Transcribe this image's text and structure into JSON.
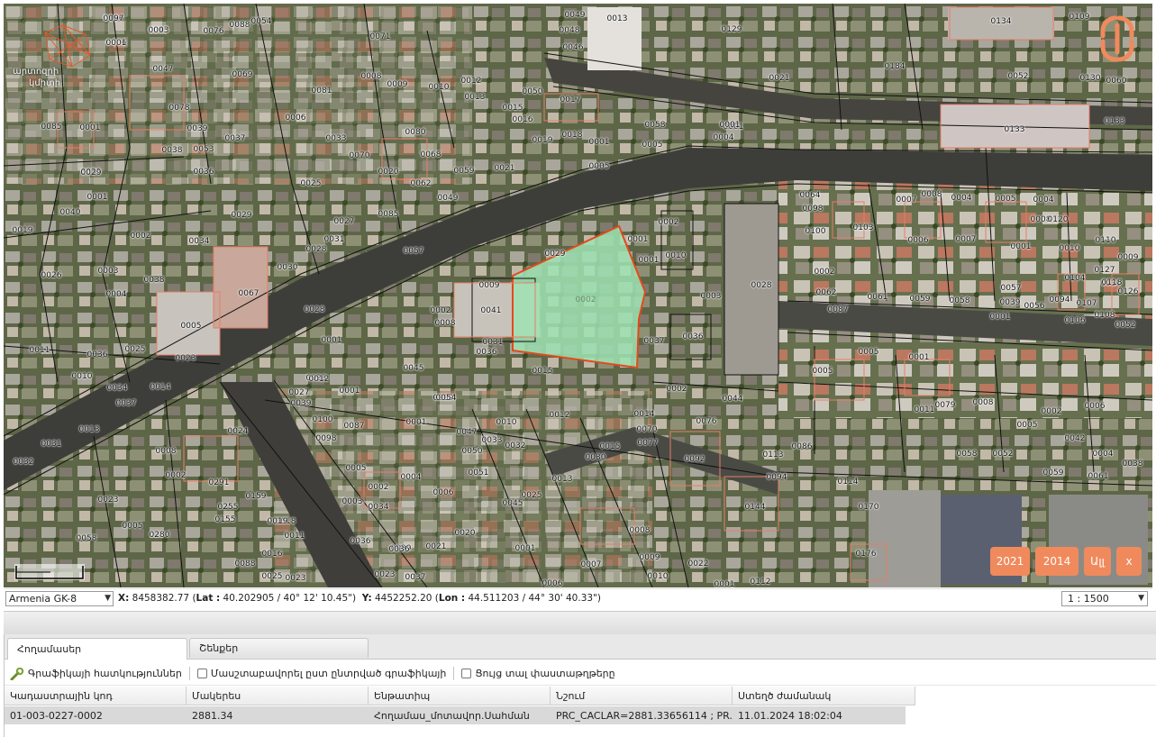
{
  "map": {
    "parcel_labels": [
      "0186",
      "0006",
      "0045",
      "0076",
      "0088",
      "0054",
      "0047",
      "0078",
      "0069",
      "0081",
      "0006",
      "0008",
      "0071",
      "0009",
      "0010",
      "0012",
      "0013",
      "0050",
      "0015",
      "0016",
      "0017",
      "0019",
      "0018",
      "0046",
      "0049",
      "0048",
      "0013",
      "0129",
      "0001",
      "0133",
      "0134",
      "0109",
      "0184",
      "0021",
      "0052",
      "0130",
      "0060",
      "0133",
      "0085",
      "0001",
      "0038",
      "0039",
      "0053",
      "0037",
      "0036",
      "0035",
      "0029",
      "0033",
      "0070",
      "0080",
      "0068",
      "0059",
      "0021",
      "0020",
      "0025",
      "0085",
      "0062",
      "0049",
      "0058",
      "0001",
      "0005",
      "0005",
      "0001",
      "0004",
      "0040",
      "0001",
      "0019",
      "0002",
      "0026",
      "0003",
      "0004",
      "0038",
      "0034",
      "0067",
      "0029",
      "0028",
      "0030",
      "0027",
      "0031",
      "0057",
      "0028",
      "0009",
      "0041",
      "0031",
      "0002",
      "0036",
      "0008",
      "0005",
      "0001",
      "0045",
      "0011",
      "0036",
      "0025",
      "0023",
      "0010",
      "0034",
      "0014",
      "0037",
      "0013",
      "0031",
      "0032",
      "0008",
      "0002",
      "0023",
      "0005",
      "0058",
      "0280",
      "0018",
      "0155",
      "0255",
      "0291",
      "0159",
      "0024",
      "0023",
      "0012",
      "0001",
      "0027",
      "0039",
      "0100",
      "0098",
      "0087",
      "0009",
      "0033",
      "0032",
      "0005",
      "0004",
      "0002",
      "0003",
      "0034",
      "0036",
      "0039",
      "0006",
      "0001",
      "0051",
      "0047",
      "0050",
      "0010",
      "0012",
      "0015",
      "0013",
      "0030",
      "0045",
      "0025",
      "0020",
      "0021",
      "0001",
      "0023",
      "0037",
      "0006",
      "0007",
      "0009",
      "0010",
      "0022",
      "0001",
      "0112",
      "0008",
      "0016",
      "0011",
      "0019",
      "0088",
      "0025",
      "0023",
      "0036",
      "0002",
      "0001",
      "0029",
      "0010",
      "0001",
      "0028",
      "0003",
      "0036",
      "0037",
      "0015",
      "0002",
      "0044",
      "0005",
      "0014",
      "0070",
      "0077",
      "0076",
      "0092",
      "0113",
      "0086",
      "0094",
      "0144",
      "0114",
      "0170",
      "0176",
      "0064",
      "0098",
      "0100",
      "0103",
      "0002",
      "0062",
      "0087",
      "0061",
      "0059",
      "0058",
      "0057",
      "0056",
      "0094",
      "0107",
      "0106",
      "0108",
      "0052",
      "0126",
      "0127",
      "0104",
      "0110",
      "0009",
      "0010",
      "0008",
      "0001",
      "0007",
      "0006",
      "0004",
      "0005",
      "0004",
      "0008",
      "0007",
      "0005",
      "0001",
      "0011",
      "0030",
      "0079",
      "0008",
      "0002",
      "0005",
      "0042",
      "0006",
      "0004",
      "0038",
      "0061",
      "0059",
      "0058",
      "0052",
      "0039",
      "0001",
      "0054",
      "0120",
      "0118",
      "0097",
      "0001",
      "0003"
    ],
    "selected_parcel_label": "0002",
    "logo_left_text_1": "արտոզրի",
    "logo_left_text_2": "կմիտի"
  },
  "year_buttons": {
    "y2021": "2021",
    "y2014": "2014",
    "all": "Ալլ",
    "close": "x"
  },
  "coord_bar": {
    "projection": "Armenia GK-8",
    "x_label": "X:",
    "x_value": "8458382.77",
    "lat_label": "Lat :",
    "lat_value": "40.202905 / 40° 12' 10.45\"",
    "y_label": "Y:",
    "y_value": "4452252.20",
    "lon_label": "Lon :",
    "lon_value": "44.511203 / 44° 30' 40.33\"",
    "scale": "1 : 1500"
  },
  "panel": {
    "tabs": [
      "Հողամասեր",
      "Շենքեր"
    ],
    "toolbar": {
      "graphic_props": "Գրաֆիկայի հատկություններ",
      "scale_to_selection": "Մասշտաբավորել ըստ ընտրված գրաֆիկայի",
      "show_documents": "Ցույց տալ փաստաթղթերը"
    },
    "columns": [
      "Կադաստրային կոդ",
      "Մակերես",
      "Ենթատիպ",
      "Նշում",
      "Ստեղծ ժամանակ"
    ],
    "rows": [
      [
        "01-003-0227-0002",
        "2881.34",
        "Հողամաս_մոտավոր.Սահման",
        "PRC_CACLAR=2881.33656114 ; PR...",
        "11.01.2024 18:02:04"
      ]
    ]
  }
}
